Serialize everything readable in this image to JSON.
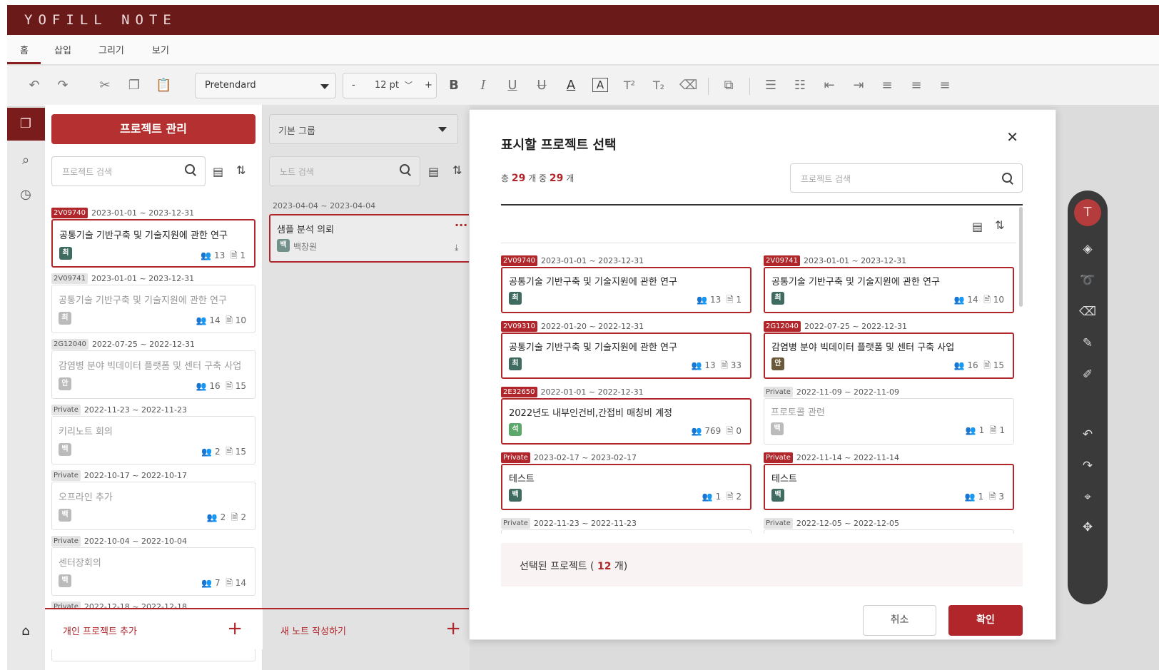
{
  "app": {
    "title": "YOFILL NOTE"
  },
  "menu": {
    "items": [
      "홈",
      "삽입",
      "그리기",
      "보기"
    ]
  },
  "toolbar": {
    "font": "Pretendard",
    "size_minus": "-",
    "size": "12 pt",
    "size_plus": "+"
  },
  "project_panel": {
    "manage_button": "프로젝트 관리",
    "search_placeholder": "프로젝트 검색",
    "cards": [
      {
        "tag": "2V09740",
        "tag_style": "red",
        "dates": "2023-01-01 ~ 2023-12-31",
        "title": "공통기술 기반구축 및 기술지원에 관한 연구",
        "badge": "최",
        "badge_color": "#3f6b61",
        "members": "13",
        "notes": "1",
        "selected": true
      },
      {
        "tag": "2V09741",
        "tag_style": "gray",
        "dates": "2023-01-01 ~ 2023-12-31",
        "title": "공통기술 기반구축 및 기술지원에 관한 연구",
        "badge": "최",
        "badge_color": "#bbbbbb",
        "members": "14",
        "notes": "10",
        "selected": false
      },
      {
        "tag": "2G12040",
        "tag_style": "gray",
        "dates": "2022-07-25 ~ 2022-12-31",
        "title": "감염병 분야 빅데이터 플랫폼 및 센터 구축 사업",
        "badge": "안",
        "badge_color": "#bbbbbb",
        "members": "16",
        "notes": "15",
        "selected": false
      },
      {
        "tag": "Private",
        "tag_style": "gray",
        "dates": "2022-11-23 ~ 2022-11-23",
        "title": "키리노트 회의",
        "badge": "백",
        "badge_color": "#bbbbbb",
        "members": "2",
        "notes": "15",
        "selected": false
      },
      {
        "tag": "Private",
        "tag_style": "gray",
        "dates": "2022-10-17 ~ 2022-10-17",
        "title": "오프라인 추가",
        "badge": "백",
        "badge_color": "#bbbbbb",
        "members": "2",
        "notes": "2",
        "selected": false
      },
      {
        "tag": "Private",
        "tag_style": "gray",
        "dates": "2022-10-04 ~ 2022-10-04",
        "title": "센터장회의",
        "badge": "백",
        "badge_color": "#bbbbbb",
        "members": "7",
        "notes": "14",
        "selected": false
      },
      {
        "tag": "Private",
        "tag_style": "gray",
        "dates": "2022-12-18 ~ 2022-12-18",
        "title": "",
        "badge": "",
        "badge_color": "#bbbbbb",
        "members": "",
        "notes": "",
        "selected": false
      }
    ],
    "add_label": "개인 프로젝트 추가"
  },
  "note_panel": {
    "group_select": "기본 그룹",
    "search_placeholder": "노트 검색",
    "card": {
      "dates": "2023-04-04 ~ 2023-04-04",
      "title": "샘플 분석 의뢰",
      "badge": "백",
      "author": "백창원"
    },
    "new_note_label": "새 노트 작성하기"
  },
  "modal": {
    "title": "표시할 프로젝트 선택",
    "count_prefix": "총",
    "count_total": "29",
    "count_mid": "개 중",
    "count_selected": "29",
    "count_suffix": "개",
    "search_placeholder": "프로젝트 검색",
    "projects": [
      {
        "tag": "2V09740",
        "tag_style": "red",
        "dates": "2023-01-01 ~ 2023-12-31",
        "title": "공통기술 기반구축 및 기술지원에 관한 연구",
        "badge": "최",
        "badge_color": "#3f6b61",
        "members": "13",
        "notes": "1",
        "selected": true
      },
      {
        "tag": "2V09741",
        "tag_style": "red",
        "dates": "2023-01-01 ~ 2023-12-31",
        "title": "공통기술 기반구축 및 기술지원에 관한 연구",
        "badge": "최",
        "badge_color": "#3f6b61",
        "members": "14",
        "notes": "10",
        "selected": true
      },
      {
        "tag": "2V09310",
        "tag_style": "red",
        "dates": "2022-01-20 ~ 2022-12-31",
        "title": "공통기술 기반구축 및 기술지원에 관한 연구",
        "badge": "최",
        "badge_color": "#3f6b61",
        "members": "13",
        "notes": "33",
        "selected": true
      },
      {
        "tag": "2G12040",
        "tag_style": "red",
        "dates": "2022-07-25 ~ 2022-12-31",
        "title": "감염병 분야 빅데이터 플랫폼 및 센터 구축 사업",
        "badge": "안",
        "badge_color": "#6b5a3a",
        "members": "16",
        "notes": "15",
        "selected": true
      },
      {
        "tag": "2E32650",
        "tag_style": "red",
        "dates": "2022-01-01 ~ 2022-12-31",
        "title": "2022년도 내부인건비,간접비 매칭비 계정",
        "badge": "석",
        "badge_color": "#5aa86a",
        "members": "769",
        "notes": "0",
        "selected": true
      },
      {
        "tag": "Private",
        "tag_style": "gray",
        "dates": "2022-11-09 ~ 2022-11-09",
        "title": "프로토콜 관련",
        "badge": "백",
        "badge_color": "#bbbbbb",
        "members": "1",
        "notes": "1",
        "selected": false
      },
      {
        "tag": "Private",
        "tag_style": "red",
        "dates": "2023-02-17 ~ 2023-02-17",
        "title": "테스트",
        "badge": "백",
        "badge_color": "#3f6b61",
        "members": "1",
        "notes": "2",
        "selected": true
      },
      {
        "tag": "Private",
        "tag_style": "red",
        "dates": "2022-11-14 ~ 2022-11-14",
        "title": "테스트",
        "badge": "백",
        "badge_color": "#3f6b61",
        "members": "1",
        "notes": "3",
        "selected": true
      },
      {
        "tag": "Private",
        "tag_style": "gray",
        "dates": "2022-11-23 ~ 2022-11-23",
        "title": "",
        "badge": "",
        "badge_color": "#bbbbbb",
        "members": "",
        "notes": "",
        "selected": false
      },
      {
        "tag": "Private",
        "tag_style": "gray",
        "dates": "2022-12-05 ~ 2022-12-05",
        "title": "",
        "badge": "",
        "badge_color": "#bbbbbb",
        "members": "",
        "notes": "",
        "selected": false
      }
    ],
    "selected_prefix": "선택된 프로젝트 (",
    "selected_count": "12",
    "selected_suffix": "개)",
    "cancel": "취소",
    "confirm": "확인"
  }
}
